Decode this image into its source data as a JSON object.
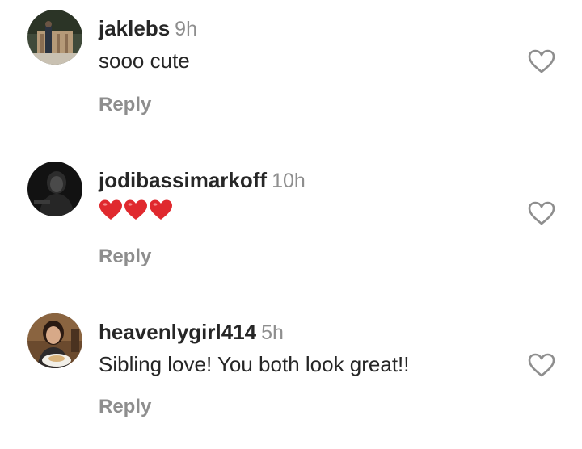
{
  "comments": [
    {
      "username": "jaklebs",
      "time": "9h",
      "text": "sooo cute",
      "reply_label": "Reply",
      "avatar_icon": "avatar-outdoor-photo"
    },
    {
      "username": "jodibassimarkoff",
      "time": "10h",
      "text": "",
      "emoji": [
        "red-heart",
        "red-heart",
        "red-heart"
      ],
      "reply_label": "Reply",
      "avatar_icon": "avatar-dark-photo"
    },
    {
      "username": "heavenlygirl414",
      "time": "5h",
      "text": "Sibling love! You both look great!!",
      "reply_label": "Reply",
      "avatar_icon": "avatar-girl-photo"
    }
  ],
  "colors": {
    "username": "#262626",
    "meta": "#8e8e8e",
    "heart_emoji": "#e0292e"
  },
  "icons": {
    "like": "heart-outline-icon"
  }
}
